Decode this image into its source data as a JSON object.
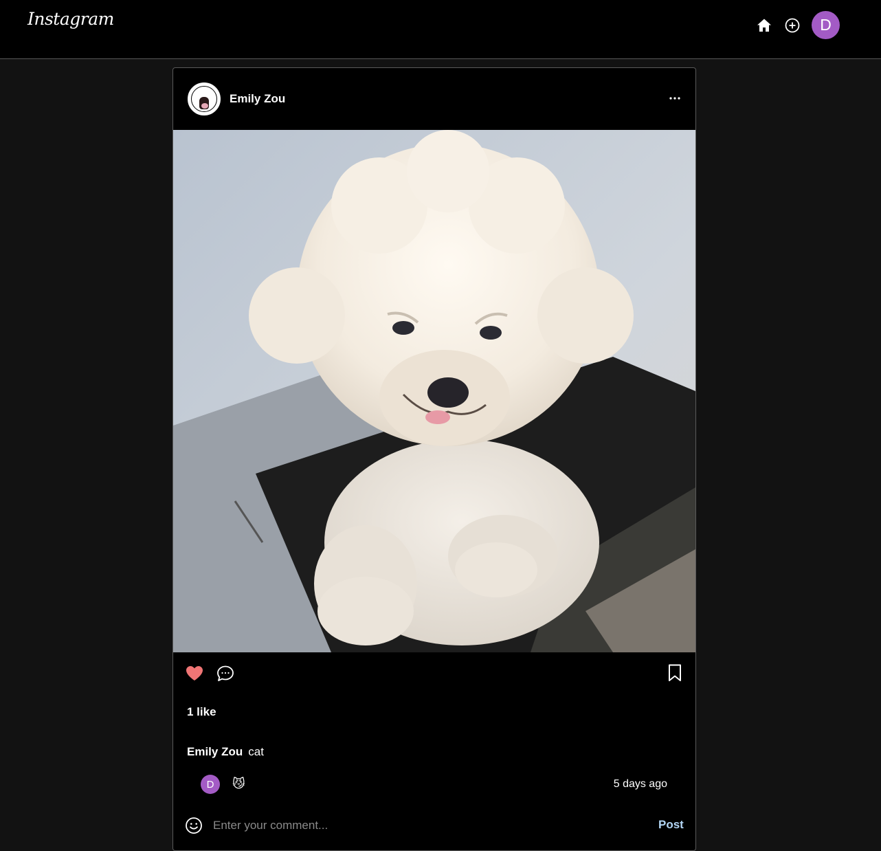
{
  "header": {
    "logo_text": "Instagram",
    "user_initial": "D",
    "avatar_color": "#a35bc5",
    "icons": [
      "home-icon",
      "create-post-icon"
    ]
  },
  "post": {
    "author": "Emily Zou",
    "image_subject": "photo of a white fluffy bichon frise dog",
    "liked": true,
    "like_color": "#f07575",
    "likes_text": "1 like",
    "caption": {
      "username": "Emily Zou",
      "text": "cat"
    },
    "comments": [
      {
        "user_initial": "D",
        "text": "😼",
        "time": "5 days ago"
      }
    ],
    "comment_input": {
      "placeholder": "Enter your comment...",
      "value": ""
    },
    "post_button_label": "Post",
    "post_button_color": "#b3d6f5"
  }
}
